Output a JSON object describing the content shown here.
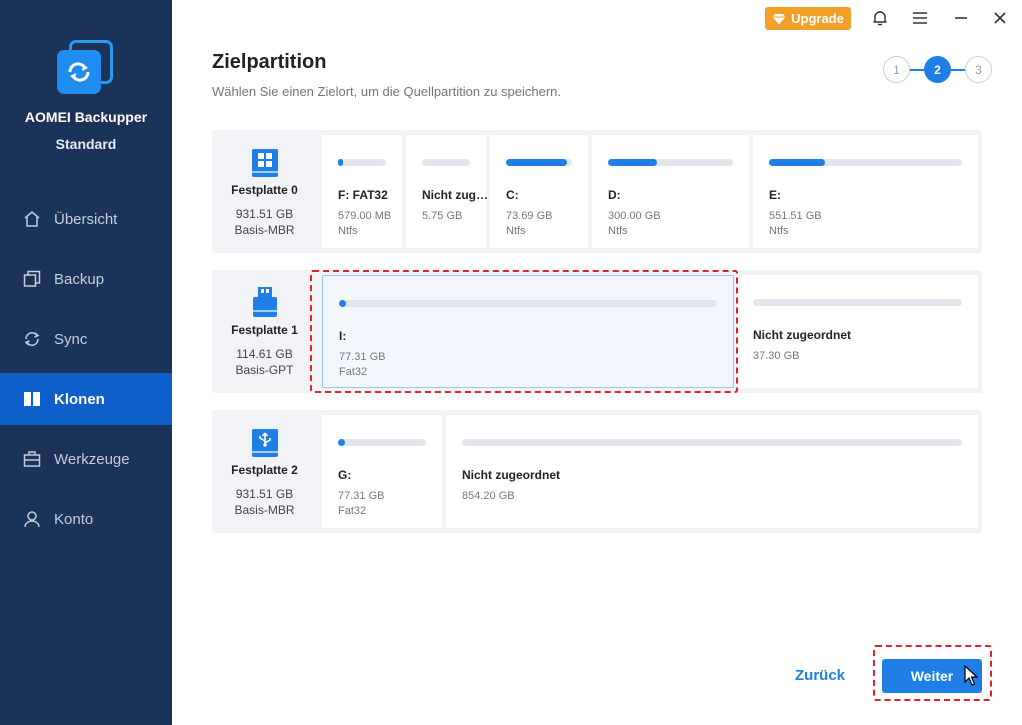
{
  "app": {
    "name": "AOMEI Backupper",
    "edition": "Standard"
  },
  "sidebar": {
    "items": [
      {
        "label": "Übersicht",
        "icon": "home-icon"
      },
      {
        "label": "Backup",
        "icon": "backup-icon"
      },
      {
        "label": "Sync",
        "icon": "sync-icon"
      },
      {
        "label": "Klonen",
        "icon": "clone-icon",
        "active": true
      },
      {
        "label": "Werkzeuge",
        "icon": "tools-icon"
      },
      {
        "label": "Konto",
        "icon": "user-icon"
      }
    ]
  },
  "titlebar": {
    "upgrade_label": "Upgrade"
  },
  "header": {
    "title": "Zielpartition",
    "subtitle": "Wählen Sie einen Zielort, um die Quellpartition zu speichern."
  },
  "stepper": {
    "steps": [
      "1",
      "2",
      "3"
    ],
    "current": 2
  },
  "disks": [
    {
      "name": "Festplatte 0",
      "size": "931.51 GB",
      "style": "Basis-MBR",
      "partitions": [
        {
          "name": "F: FAT32",
          "size": "579.00 MB",
          "fs": "Ntfs",
          "used": 0.1
        },
        {
          "name": "Nicht zug…",
          "size": "5.75 GB",
          "fs": "",
          "used": 0
        },
        {
          "name": "C:",
          "size": "73.69 GB",
          "fs": "Ntfs",
          "used": 0.93
        },
        {
          "name": "D:",
          "size": "300.00 GB",
          "fs": "Ntfs",
          "used": 0.39
        },
        {
          "name": "E:",
          "size": "551.51 GB",
          "fs": "Ntfs",
          "used": 0.29
        }
      ]
    },
    {
      "name": "Festplatte 1",
      "size": "114.61 GB",
      "style": "Basis-GPT",
      "partitions": [
        {
          "name": "I:",
          "size": "77.31 GB",
          "fs": "Fat32",
          "used": 0.01
        },
        {
          "name": "Nicht zugeordnet",
          "size": "37.30 GB",
          "fs": "",
          "used": 0
        }
      ]
    },
    {
      "name": "Festplatte 2",
      "size": "931.51 GB",
      "style": "Basis-MBR",
      "partitions": [
        {
          "name": "G:",
          "size": "77.31 GB",
          "fs": "Fat32",
          "used": 0.03
        },
        {
          "name": "Nicht zugeordnet",
          "size": "854.20 GB",
          "fs": "",
          "used": 0
        }
      ]
    }
  ],
  "footer": {
    "back_label": "Zurück",
    "next_label": "Weiter"
  },
  "colors": {
    "accent": "#1f7fe6",
    "sidebar": "#1b3358",
    "upgrade": "#f2a02a",
    "highlight": "#e0202a"
  }
}
